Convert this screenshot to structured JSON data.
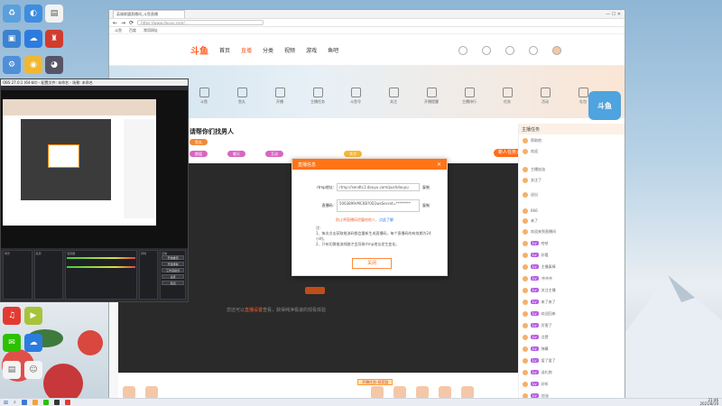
{
  "browser": {
    "tab_title": "英雄联盟直播间_斗鱼直播",
    "url": "https://www.douyu.com/...",
    "bookmarks": [
      "斗鱼",
      "百度",
      "常用网址"
    ]
  },
  "douyu": {
    "logo": "斗鱼",
    "nav": [
      "首页",
      "直播",
      "分类",
      "视频",
      "游戏",
      "鱼吧"
    ],
    "active_nav": "直播",
    "tools": [
      "斗鱼",
      "鱼丸",
      "开播",
      "主播任务",
      "斗鱼号",
      "关注",
      "开播提醒",
      "主播排行",
      "任务",
      "活动",
      "礼包",
      "直播中心"
    ]
  },
  "room": {
    "title": "请帮你们找男人",
    "pills": [
      "鱼丸",
      "颜值",
      "聊天",
      "互动",
      "关注"
    ],
    "task_button": "新人任务大奖",
    "note_prefix": "您还可以",
    "note_link": "直播设置",
    "note_suffix": "查看，获得纯净极速的观看体验",
    "promo": "开播任务·领奖励"
  },
  "chat": {
    "header": "主播任务",
    "rows": [
      "帮助他",
      "欢迎",
      "主播加油",
      "关注了",
      "送出",
      "666",
      "来了",
      "欢迎来到直播间",
      "哈哈",
      "好看",
      "主播真棒",
      "冲冲冲",
      "关注主播",
      "来了来了",
      "欢迎回来",
      "厉害了",
      "点赞",
      "弹幕",
      "爱了爱了",
      "送礼物",
      "好听",
      "加油"
    ],
    "mascot": "斗鱼"
  },
  "dialog": {
    "title": "直播信息",
    "close_icon": "close-icon",
    "rtmp_label": "rtmp地址:",
    "rtmp_value": "rtmp://sendtc1.douyu.com/pushdouyu",
    "code_label": "直播码:",
    "code_value": "5063899rMCKB?0D1wsSecret=********",
    "copy_label": "复制",
    "warn_text": "防止将直播码泄露给他人，",
    "warn_link": "点此了解",
    "notes_title": "注:",
    "note1": "1、每次点击获取推流码都会重新生成直播码，每个直播码的有效期为24小时。",
    "note2": "2、只有切换推流线路才会导致rtmp地址发生变化。",
    "close_button": "关闭"
  },
  "obs": {
    "title": "OBS 27.0.1 (64-bit) - 配置文件: 未命名 - 场景: 未命名",
    "panels": [
      "场景",
      "来源",
      "混音器",
      "转场",
      "控制"
    ],
    "buttons": [
      "开始推流",
      "开始录制",
      "工作室模式",
      "设置",
      "退出"
    ]
  },
  "taskbar": {
    "time": "21:46",
    "date": "2021/8/19"
  }
}
